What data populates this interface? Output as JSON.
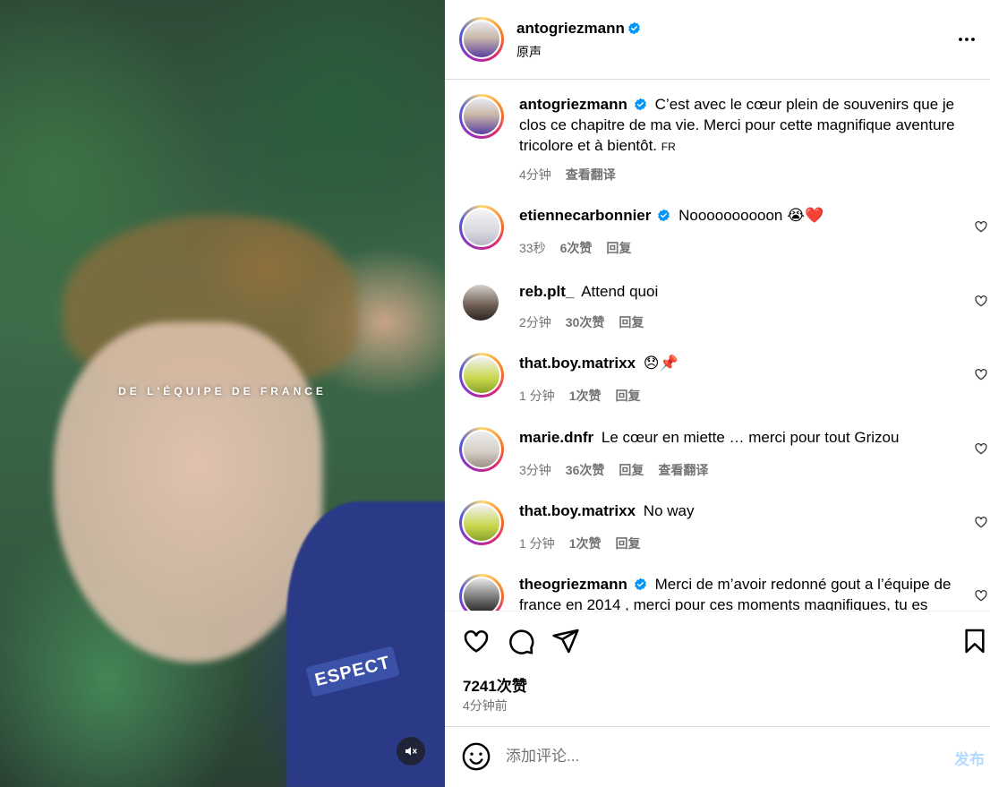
{
  "media": {
    "overlay_text": "DE L'ÉQUIPE DE FRANCE",
    "patch_text": "ESPECT",
    "mute_icon": "speaker-muted-icon"
  },
  "header": {
    "username": "antogriezmann",
    "verified": true,
    "audio_label": "原声",
    "more_icon": "more-horizontal-icon"
  },
  "caption": {
    "username": "antogriezmann",
    "text": "C’est avec le cœur plein de souvenirs que je clos ce chapitre de ma vie. Merci pour cette magnifique aventure tricolore et à bientôt.",
    "lang": "FR",
    "time": "4分钟",
    "translate": "查看翻译"
  },
  "comments": [
    {
      "username": "etiennecarbonnier",
      "verified": true,
      "text": "Noooooooooon 😭❤️",
      "time": "33秒",
      "likes": "6次赞",
      "reply": "回复",
      "translate": "",
      "ring": true
    },
    {
      "username": "reb.plt_",
      "verified": false,
      "text": "Attend quoi",
      "time": "2分钟",
      "likes": "30次赞",
      "reply": "回复",
      "translate": "",
      "ring": false
    },
    {
      "username": "that.boy.matrixx",
      "verified": false,
      "text": "😞📌",
      "time": "1 分钟",
      "likes": "1次赞",
      "reply": "回复",
      "translate": "",
      "ring": true
    },
    {
      "username": "marie.dnfr",
      "verified": false,
      "text": "Le cœur en miette … merci pour tout Grizou",
      "time": "3分钟",
      "likes": "36次赞",
      "reply": "回复",
      "translate": "查看翻译",
      "ring": true
    },
    {
      "username": "that.boy.matrixx",
      "verified": false,
      "text": "No way",
      "time": "1 分钟",
      "likes": "1次赞",
      "reply": "回复",
      "translate": "",
      "ring": true
    },
    {
      "username": "theogriezmann",
      "verified": true,
      "text": "Merci de m’avoir redonné gout a l’équipe de france en 2014 , merci pour ces moments magnifiques, tu es",
      "time": "",
      "likes": "",
      "reply": "",
      "translate": "",
      "ring": true
    }
  ],
  "actions": {
    "like_icon": "heart-icon",
    "comment_icon": "comment-icon",
    "share_icon": "paper-plane-icon",
    "save_icon": "bookmark-icon",
    "likes": "7241次赞",
    "time": "4分钟前"
  },
  "add_comment": {
    "placeholder": "添加评论...",
    "post_label": "发布",
    "emoji_icon": "smiley-icon"
  },
  "colors": {
    "verified_blue": "#0095f6",
    "muted_text": "#737373",
    "post_disabled": "#b3dbff"
  }
}
